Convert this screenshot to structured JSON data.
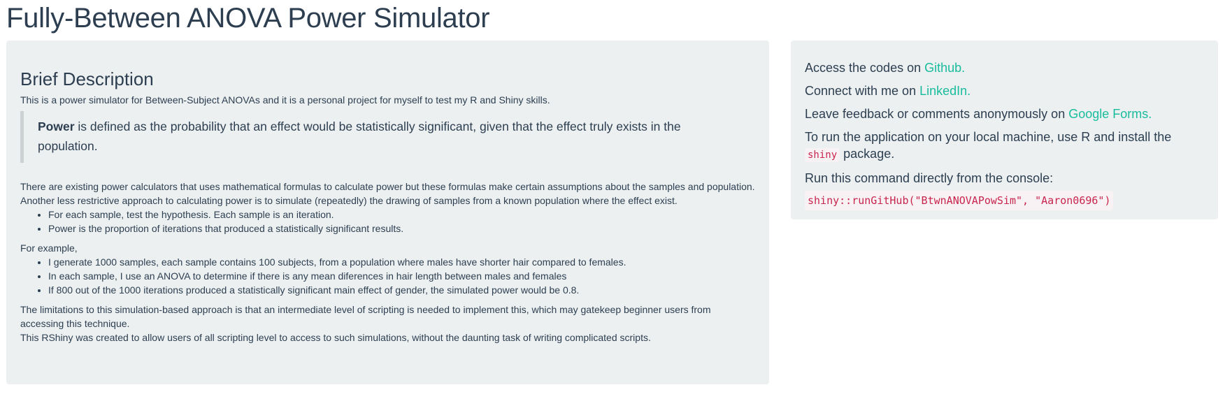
{
  "title": "Fully-Between ANOVA Power Simulator",
  "left": {
    "heading": "Brief Description",
    "intro": "This is a power simulator for Between-Subject ANOVAs and it is a personal project for myself to test my R and Shiny skills.",
    "quote_bold": "Power",
    "quote_rest": " is defined as the probability that an effect would be statistically significant, given that the effect truly exists in the population.",
    "para1": "There are existing power calculators that uses mathematical formulas to calculate power but these formulas make certain assumptions about the samples and population.",
    "para2": "Another less restrictive approach to calculating power is to simulate (repeatedly) the drawing of samples from a known population where the effect exist.",
    "list1": [
      "For each sample, test the hypothesis. Each sample is an iteration.",
      "Power is the proportion of iterations that produced a statistically significant results."
    ],
    "example_label": "For example,",
    "list2": [
      "I generate 1000 samples, each sample contains 100 subjects, from a population where males have shorter hair compared to females.",
      "In each sample, I use an ANOVA to determine if there is any mean diferences in hair length between males and females",
      "If 800 out of the 1000 iterations produced a statistically significant main effect of gender, the simulated power would be 0.8."
    ],
    "para3": "The limitations to this simulation-based approach is that an intermediate level of scripting is needed to implement this, which may gatekeep beginner users from accessing this technique.",
    "para4": "This RShiny was created to allow users of all scripting level to access to such simulations, without the daunting task of writing complicated scripts."
  },
  "right": {
    "github_text": "Access the codes on ",
    "github_link": "Github.",
    "linkedin_text": "Connect with me on ",
    "linkedin_link": "LinkedIn.",
    "forms_text": "Leave feedback or comments anonymously on ",
    "forms_link": "Google Forms.",
    "install_text": "To run the application on your local machine, use R and install the ",
    "install_code": "shiny",
    "install_after": " package.",
    "run_text": "Run this command directly from the console:",
    "command": "shiny::runGitHub(\"BtwnANOVAPowSim\", \"Aaron0696\")"
  },
  "colors": {
    "link": "#18bc9c",
    "code": "#c7254e",
    "well": "#ecf0f1",
    "text": "#2c3e50"
  }
}
